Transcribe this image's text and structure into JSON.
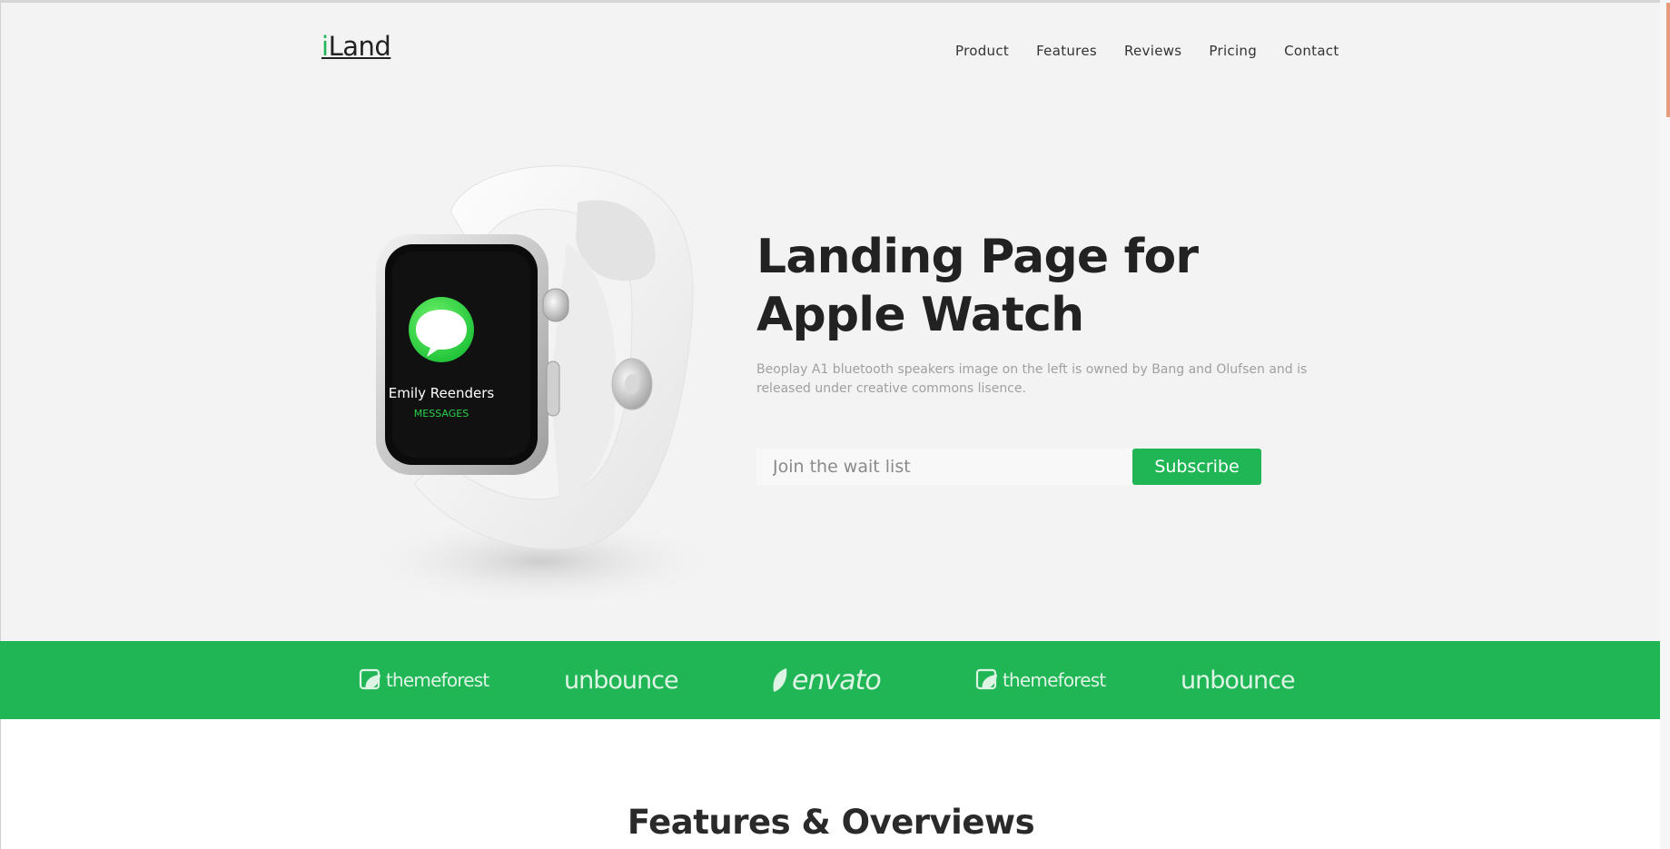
{
  "header": {
    "logo_accent": "i",
    "logo_text": "Land",
    "nav": [
      "Product",
      "Features",
      "Reviews",
      "Pricing",
      "Contact"
    ]
  },
  "hero": {
    "title": "Landing Page for Apple Watch",
    "description": "Beoplay A1 bluetooth speakers image on the left is owned by Bang and Olufsen and is released under creative commons lisence.",
    "watch_screen_name": "Emily Reenders",
    "watch_screen_app": "MESSAGES",
    "input_placeholder": "Join the wait list",
    "subscribe_label": "Subscribe"
  },
  "brands": [
    "themeforest",
    "unbounce",
    "envato",
    "themeforest",
    "unbounce"
  ],
  "features": {
    "title": "Features & Overviews"
  },
  "colors": {
    "accent": "#20b655",
    "hero_bg": "#f3f3f3",
    "headline": "#222222",
    "muted_text": "#a0a0a0"
  }
}
